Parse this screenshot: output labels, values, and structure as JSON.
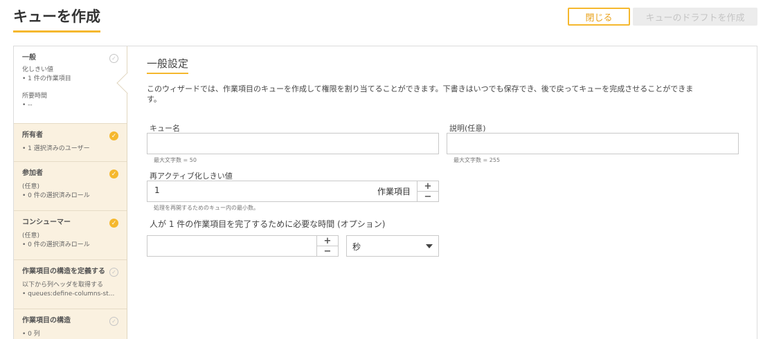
{
  "page": {
    "title": "キューを作成",
    "close_label": "閉じる",
    "draft_label": "キューのドラフトを作成"
  },
  "sidebar": {
    "steps": [
      {
        "title": "一般",
        "lines": [
          "化しきい値",
          "• 1 件の作業項目",
          "所要時間",
          "• --"
        ],
        "status": "pending",
        "active": true
      },
      {
        "title": "所有者",
        "lines": [
          "• 1 選択済みのユーザー"
        ],
        "status": "done"
      },
      {
        "title": "参加者",
        "lines": [
          "(任意)",
          "• 0 件の選択済みロール"
        ],
        "status": "done"
      },
      {
        "title": "コンシューマー",
        "lines": [
          "(任意)",
          "• 0 件の選択済みロール"
        ],
        "status": "done"
      },
      {
        "title": "作業項目の構造を定義する",
        "lines": [
          "以下から列ヘッダを取得する",
          "• queues:define-columns-st..."
        ],
        "status": "pending"
      },
      {
        "title": "作業項目の構造",
        "lines": [
          "• 0 列"
        ],
        "status": "pending"
      }
    ]
  },
  "general": {
    "section_title": "一般設定",
    "description": "このウィザードでは、作業項目のキューを作成して権限を割り当てることができます。下書きはいつでも保存でき、後で戻ってキューを完成させることができます。",
    "queue_name_label": "キュー名",
    "queue_name_value": "",
    "queue_name_hint": "最大文字数 = 50",
    "description_label": "説明(任意)",
    "description_value": "",
    "description_hint": "最大文字数 = 255",
    "reactivation_label": "再アクティブ化しきい値",
    "reactivation_value": "1",
    "reactivation_unit": "作業項目",
    "reactivation_hint": "処理を再開するためのキュー内の最小数。",
    "time_label": "人が 1 件の作業項目を完了するために必要な時間 (オプション)",
    "time_value": "",
    "time_unit_selected": "秒"
  },
  "icons": {
    "check_done": "check-circle-filled-icon",
    "check_pending": "check-circle-outline-icon",
    "plus": "plus-icon",
    "minus": "minus-icon",
    "caret": "caret-down-icon"
  },
  "colors": {
    "accent": "#f5b82e",
    "sidebar_bg": "#faf1e0",
    "disabled_bg": "#ececec"
  }
}
